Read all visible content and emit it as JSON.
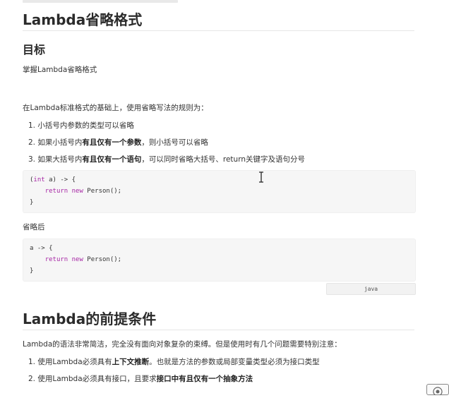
{
  "section1": {
    "title": "Lambda省略格式",
    "goal_heading": "目标",
    "goal_text": "掌握Lambda省略格式",
    "intro": "在Lambda标准格式的基础上，使用省略写法的规则为：",
    "rules": [
      {
        "num": "1.",
        "before": "小括号内参数的类型可以省略",
        "bold": "",
        "after": ""
      },
      {
        "num": "2.",
        "before": "如果小括号内",
        "bold": "有且仅有一个参数",
        "after": "，则小括号可以省略"
      },
      {
        "num": "3.",
        "before": "如果大括号内",
        "bold": "有且仅有一个语句",
        "after": "，可以同时省略大括号、return关键字及语句分号"
      }
    ],
    "code1": {
      "line1_paren_open": "(",
      "line1_type": "int",
      "line1_rest": " a) -> {",
      "line2_kw_return": "return",
      "line2_kw_new": "new",
      "line2_rest": " Person();",
      "line3": "}"
    },
    "after_label": "省略后",
    "code2": {
      "line1": "a -> {",
      "line2_kw_return": "return",
      "line2_kw_new": "new",
      "line2_rest": " Person();",
      "line3": "}"
    },
    "code_lang": "java"
  },
  "section2": {
    "title": "Lambda的前提条件",
    "intro": "Lambda的语法非常简洁，完全没有面向对象复杂的束缚。但是使用时有几个问题需要特别注意：",
    "rules": [
      {
        "num": "1.",
        "before": "使用Lambda必须具有",
        "bold": "上下文推断",
        "after": "。也就是方法的参数或局部变量类型必须为接口类型"
      },
      {
        "num": "2.",
        "before": "使用Lambda必须具有接口，且要求",
        "bold": "接口中有且仅有一个抽象方法",
        "after": ""
      }
    ]
  },
  "icons": {
    "cursor": "text-cursor-icon",
    "corner": "app-logo-icon"
  }
}
